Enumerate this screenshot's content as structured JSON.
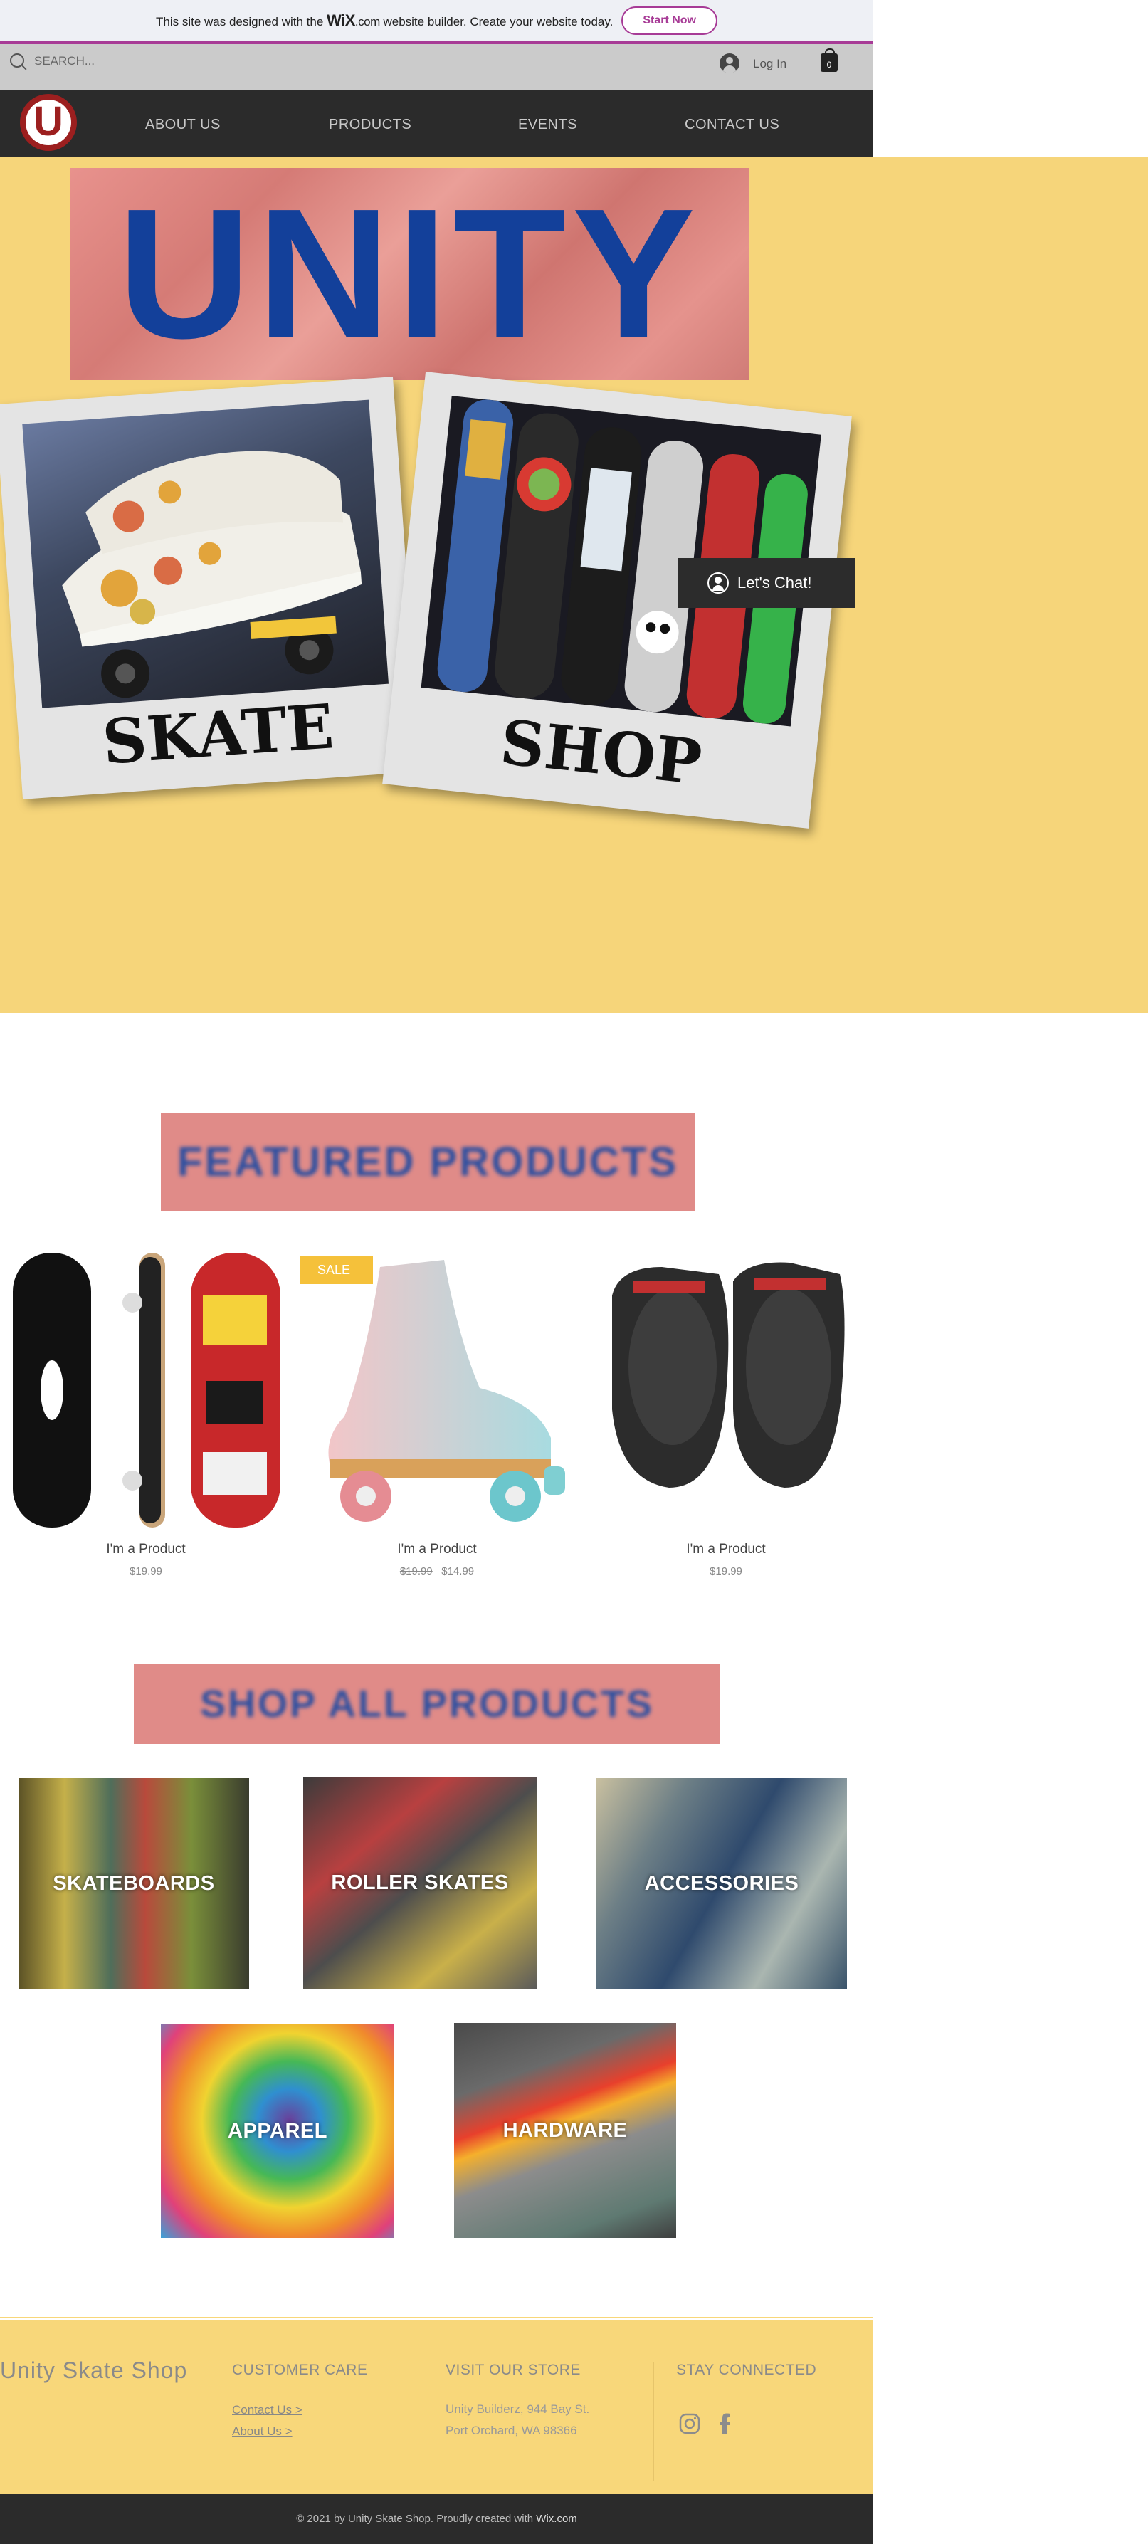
{
  "wix_banner": {
    "text_before": "This site was designed with the",
    "brand": "WiX",
    "brand_suffix": ".com",
    "text_after": "website builder. Create your website today.",
    "cta": "Start Now"
  },
  "header": {
    "search_placeholder": "SEARCH...",
    "login_label": "Log In",
    "cart_count": "0"
  },
  "logo": {
    "letter": "U"
  },
  "nav": {
    "items": [
      {
        "label": "ABOUT US"
      },
      {
        "label": "PRODUCTS"
      },
      {
        "label": "EVENTS"
      },
      {
        "label": "CONTACT US"
      }
    ]
  },
  "hero": {
    "title": "UNITY",
    "left_caption": "SKATE",
    "right_caption": "SHOP"
  },
  "chat": {
    "label": "Let's Chat!"
  },
  "featured": {
    "title": "FEATURED PRODUCTS",
    "products": [
      {
        "name": "I'm a Product",
        "price": "$19.99"
      },
      {
        "name": "I'm a Product",
        "old_price": "$19.99",
        "price": "$14.99",
        "badge": "SALE"
      },
      {
        "name": "I'm a Product",
        "price": "$19.99"
      }
    ]
  },
  "shop_all": {
    "title": "SHOP ALL PRODUCTS",
    "categories": [
      {
        "label": "SKATEBOARDS"
      },
      {
        "label": "ROLLER SKATES"
      },
      {
        "label": "ACCESSORIES"
      },
      {
        "label": "APPAREL"
      },
      {
        "label": "HARDWARE"
      }
    ]
  },
  "footer": {
    "brand": "Unity Skate Shop",
    "customer_care": {
      "title": "CUSTOMER CARE",
      "links": [
        "Contact Us >",
        "About Us >"
      ]
    },
    "visit": {
      "title": "VISIT OUR STORE",
      "address_line1": "Unity Builderz, 944 Bay St.",
      "address_line2": "Port Orchard, WA 98366"
    },
    "stay_connected": {
      "title": "STAY CONNECTED"
    },
    "copyright": "© 2021 by Unity Skate Shop. Proudly created with",
    "copyright_link": "Wix.com"
  }
}
